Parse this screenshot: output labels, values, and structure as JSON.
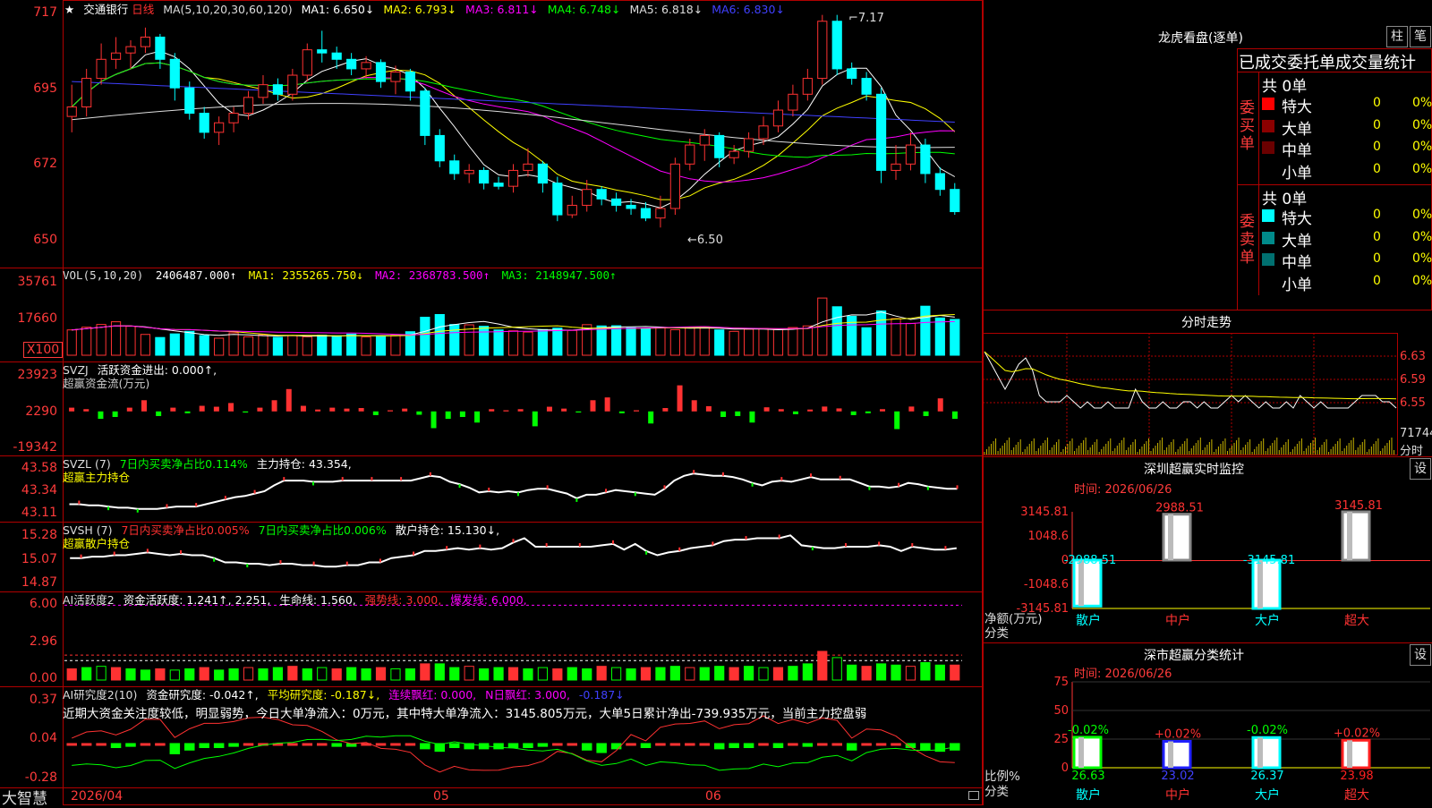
{
  "app": {
    "brand": "大智慧",
    "date_axis": [
      "2026/04",
      "05",
      "06"
    ]
  },
  "main": {
    "name": "交通银行",
    "period": "日线",
    "ma_label": "MA(5,10,20,30,60,120)",
    "ma1": "MA1: 6.650↓",
    "ma2": "MA2: 6.793↓",
    "ma3": "MA3: 6.811↓",
    "ma4": "MA4: 6.748↓",
    "ma5": "MA5: 6.818↓",
    "ma6": "MA6: 6.830↓",
    "high_mark": "7.17",
    "low_mark": "←6.50",
    "ticks": [
      "717",
      "695",
      "672",
      "650"
    ]
  },
  "vol": {
    "label": "VOL(5,10,20)",
    "v": "2406487.000↑",
    "ma1": "MA1: 2355265.750↓",
    "ma2": "MA2: 2368783.500↑",
    "ma3": "MA3: 2148947.500↑",
    "ticks": [
      "35761",
      "17660",
      "X100"
    ]
  },
  "svzj": {
    "label": "SVZJ",
    "l1": "活跃资金进出: 0.000↑,",
    "l2": "超赢资金流(万元)",
    "ticks": [
      "23923",
      "2290",
      "-19342"
    ]
  },
  "svzl": {
    "label": "SVZL (7)",
    "l1": "7日内买卖净占比0.114%",
    "l2": "主力持仓: 43.354,",
    "l3": "超赢主力持仓",
    "ticks": [
      "43.58",
      "43.34",
      "43.11"
    ]
  },
  "svsh": {
    "label": "SVSH (7)",
    "l1": "7日内买卖净占比0.005%",
    "l2": "7日内买卖净占比0.006%",
    "l3": "散户持仓: 15.130↓,",
    "l4": "超赢散户持仓",
    "ticks": [
      "15.28",
      "15.07",
      "14.87"
    ]
  },
  "ai1": {
    "label": "AI活跃度2",
    "l1": "资金活跃度: 1.241↑, 2.251,",
    "l2": "生命线: 1.560,",
    "l3": "强势线: 3.000,",
    "l4": "爆发线: 6.000,",
    "ticks": [
      "6.00",
      "2.96",
      "0.00"
    ]
  },
  "ai2": {
    "label": "AI研究度2(10)",
    "l1": "资金研究度: -0.042↑,",
    "l2": "平均研究度: -0.187↓,",
    "l3": "连续飘红: 0.000,",
    "l4": "N日飘红: 3.000,",
    "l5": "-0.187↓",
    "comment": "近期大资金关注度较低，明显弱势，今日大单净流入：0万元，其中特大单净流入：3145.805万元，大单5日累计净出-739.935万元，当前主力控盘弱",
    "ticks": [
      "0.37",
      "0.04",
      "-0.28"
    ]
  },
  "lhb": {
    "title": "龙虎看盘(逐单)",
    "btn1": "柱",
    "btn2": "笔",
    "tabs": [
      "已成交",
      "委托单",
      "成交量统计"
    ],
    "buy": {
      "side": "委买单",
      "total": "共 0单",
      "rows": [
        {
          "name": "特大",
          "v": "0",
          "p": "0%",
          "c": "#ff0000"
        },
        {
          "name": "大单",
          "v": "0",
          "p": "0%",
          "c": "#8b0000"
        },
        {
          "name": "中单",
          "v": "0",
          "p": "0%",
          "c": "#6a0000"
        },
        {
          "name": "小单",
          "v": "0",
          "p": "0%",
          "c": ""
        }
      ]
    },
    "sell": {
      "side": "委卖单",
      "total": "共 0单",
      "rows": [
        {
          "name": "特大",
          "v": "0",
          "p": "0%",
          "c": "#00ffff"
        },
        {
          "name": "大单",
          "v": "0",
          "p": "0%",
          "c": "#008b8b"
        },
        {
          "name": "中单",
          "v": "0",
          "p": "0%",
          "c": "#007070"
        },
        {
          "name": "小单",
          "v": "0",
          "p": "0%",
          "c": ""
        }
      ]
    }
  },
  "fenshi": {
    "title": "分时走势",
    "ticks": [
      "6.63",
      "6.59",
      "6.55"
    ],
    "vol_tick": "71744",
    "footer": "分时"
  },
  "monitor": {
    "title": "深圳超赢实时监控",
    "btn": "设",
    "time": "时间: 2026/06/26",
    "ticks": [
      "3145.81",
      "1048.6",
      "0",
      "-1048.6",
      "-3145.81"
    ],
    "axis_title": "净额(万元)",
    "axis_cat": "分类"
  },
  "stats": {
    "title": "深市超赢分类统计",
    "btn": "设",
    "time": "时间: 2026/06/26",
    "ticks": [
      "75",
      "50",
      "25",
      "0"
    ],
    "axis_title": "比例%",
    "axis_cat": "分类"
  },
  "chart_data": [
    {
      "type": "candlestick",
      "title": "交通银行 日线",
      "ylim": [
        6.45,
        7.2
      ],
      "x": [
        "2026/04",
        "05",
        "06"
      ],
      "candles": [
        [
          6.85,
          6.88,
          6.95,
          6.8
        ],
        [
          6.88,
          6.97,
          7.0,
          6.85
        ],
        [
          6.97,
          7.03,
          7.08,
          6.95
        ],
        [
          7.03,
          7.05,
          7.1,
          7.0
        ],
        [
          7.05,
          7.07,
          7.09,
          7.0
        ],
        [
          7.07,
          7.1,
          7.13,
          7.05
        ],
        [
          7.1,
          7.03,
          7.11,
          7.0
        ],
        [
          7.03,
          6.94,
          7.05,
          6.9
        ],
        [
          6.94,
          6.86,
          6.96,
          6.84
        ],
        [
          6.86,
          6.8,
          6.88,
          6.78
        ],
        [
          6.8,
          6.83,
          6.85,
          6.76
        ],
        [
          6.83,
          6.86,
          6.88,
          6.8
        ],
        [
          6.86,
          6.91,
          6.93,
          6.84
        ],
        [
          6.91,
          6.95,
          6.98,
          6.89
        ],
        [
          6.95,
          6.92,
          6.97,
          6.9
        ],
        [
          6.92,
          6.98,
          7.0,
          6.9
        ],
        [
          6.98,
          7.06,
          7.08,
          6.96
        ],
        [
          7.06,
          7.05,
          7.12,
          7.02
        ],
        [
          7.05,
          7.03,
          7.07,
          7.0
        ],
        [
          7.03,
          7.0,
          7.05,
          6.98
        ],
        [
          7.0,
          7.02,
          7.04,
          6.97
        ],
        [
          7.02,
          6.96,
          7.03,
          6.94
        ],
        [
          6.96,
          6.99,
          7.01,
          6.92
        ],
        [
          6.99,
          6.93,
          7.0,
          6.9
        ],
        [
          6.93,
          6.79,
          6.94,
          6.76
        ],
        [
          6.79,
          6.71,
          6.81,
          6.69
        ],
        [
          6.71,
          6.67,
          6.73,
          6.65
        ],
        [
          6.67,
          6.68,
          6.7,
          6.64
        ],
        [
          6.68,
          6.64,
          6.69,
          6.62
        ],
        [
          6.64,
          6.63,
          6.66,
          6.62
        ],
        [
          6.63,
          6.68,
          6.7,
          6.61
        ],
        [
          6.68,
          6.7,
          6.75,
          6.66
        ],
        [
          6.7,
          6.64,
          6.71,
          6.61
        ],
        [
          6.64,
          6.54,
          6.66,
          6.52
        ],
        [
          6.54,
          6.57,
          6.6,
          6.53
        ],
        [
          6.57,
          6.62,
          6.65,
          6.55
        ],
        [
          6.62,
          6.59,
          6.63,
          6.57
        ],
        [
          6.59,
          6.57,
          6.61,
          6.55
        ],
        [
          6.57,
          6.56,
          6.59,
          6.54
        ],
        [
          6.56,
          6.53,
          6.58,
          6.52
        ],
        [
          6.53,
          6.56,
          6.6,
          6.5
        ],
        [
          6.56,
          6.7,
          6.72,
          6.54
        ],
        [
          6.7,
          6.76,
          6.78,
          6.68
        ],
        [
          6.76,
          6.79,
          6.81,
          6.71
        ],
        [
          6.79,
          6.72,
          6.8,
          6.69
        ],
        [
          6.72,
          6.74,
          6.76,
          6.7
        ],
        [
          6.74,
          6.78,
          6.8,
          6.72
        ],
        [
          6.78,
          6.82,
          6.85,
          6.76
        ],
        [
          6.82,
          6.87,
          6.9,
          6.8
        ],
        [
          6.87,
          6.92,
          6.95,
          6.85
        ],
        [
          6.92,
          6.97,
          7.0,
          6.9
        ],
        [
          6.97,
          7.15,
          7.17,
          6.95
        ],
        [
          7.15,
          7.0,
          7.17,
          6.98
        ],
        [
          7.0,
          6.97,
          7.02,
          6.95
        ],
        [
          6.97,
          6.92,
          6.99,
          6.9
        ],
        [
          6.92,
          6.68,
          6.94,
          6.64
        ],
        [
          6.68,
          6.7,
          6.76,
          6.65
        ],
        [
          6.7,
          6.76,
          6.8,
          6.68
        ],
        [
          6.76,
          6.67,
          6.78,
          6.64
        ],
        [
          6.67,
          6.62,
          6.69,
          6.6
        ],
        [
          6.62,
          6.55,
          6.64,
          6.54
        ]
      ],
      "series": [
        {
          "name": "MA1",
          "value": 6.65
        },
        {
          "name": "MA2",
          "value": 6.793
        },
        {
          "name": "MA3",
          "value": 6.811
        },
        {
          "name": "MA4",
          "value": 6.748
        },
        {
          "name": "MA5",
          "value": 6.818
        },
        {
          "name": "MA6",
          "value": 6.83
        }
      ],
      "annotations": [
        "7.17",
        "←6.50"
      ]
    },
    {
      "type": "bar",
      "title": "VOL(5,10,20)",
      "ylim": [
        0,
        45000
      ],
      "values": [
        14000,
        15500,
        17000,
        18500,
        16000,
        11500,
        9800,
        11800,
        13200,
        10900,
        9400,
        12400,
        10200,
        11300,
        9900,
        10800,
        10200,
        11100,
        10800,
        11700,
        10100,
        10600,
        11000,
        13000,
        21000,
        22500,
        17000,
        16800,
        16000,
        14000,
        13500,
        12800,
        14200,
        15000,
        13700,
        16900,
        16200,
        16300,
        15200,
        14800,
        15300,
        14100,
        15500,
        15700,
        14000,
        13200,
        14400,
        14800,
        14100,
        15300,
        16200,
        31600,
        26800,
        21500,
        15200,
        24500,
        20200,
        17600,
        27100,
        20600,
        19800
      ],
      "series": [
        {
          "name": "VOL",
          "value": 2406487.0
        },
        {
          "name": "MA1",
          "value": 2355265.75
        },
        {
          "name": "MA2",
          "value": 2368783.5
        },
        {
          "name": "MA3",
          "value": 2148947.5
        }
      ]
    },
    {
      "type": "bar",
      "title": "超赢资金流(万元)",
      "ylim": [
        -19342,
        23923
      ],
      "values": [
        2000,
        1200,
        -4000,
        -3000,
        2000,
        6000,
        -2500,
        2000,
        -1000,
        3000,
        2500,
        4500,
        -600,
        2000,
        6000,
        12000,
        3000,
        1000,
        2000,
        1500,
        1800,
        -2000,
        600,
        1500,
        -1800,
        -9000,
        -4000,
        -3000,
        -6000,
        1200,
        600,
        1200,
        -8000,
        2500,
        1500,
        -600,
        6000,
        7500,
        -1000,
        600,
        -6500,
        1800,
        14000,
        6000,
        2800,
        -3000,
        -2500,
        -6000,
        2200,
        1200,
        -1500,
        1000,
        2600,
        1600,
        -2000,
        -1000,
        1200,
        -9500,
        2600,
        -2500,
        7000,
        -4000
      ],
      "series": [
        {
          "name": "活跃资金进出",
          "value": 0.0
        }
      ]
    },
    {
      "type": "line",
      "title": "超赢主力持仓",
      "ylim": [
        43.11,
        43.58
      ],
      "values": [
        43.22,
        43.22,
        43.21,
        43.21,
        43.2,
        43.19,
        43.19,
        43.18,
        43.18,
        43.18,
        43.19,
        43.2,
        43.2,
        43.2,
        43.22,
        43.24,
        43.26,
        43.28,
        43.29,
        43.31,
        43.33,
        43.38,
        43.42,
        43.42,
        43.42,
        43.41,
        43.41,
        43.41,
        43.42,
        43.42,
        43.42,
        43.42,
        43.42,
        43.42,
        43.42,
        43.42,
        43.44,
        43.46,
        43.45,
        43.41,
        43.39,
        43.36,
        43.32,
        43.33,
        43.32,
        43.33,
        43.32,
        43.34,
        43.35,
        43.35,
        43.33,
        43.31,
        43.27,
        43.3,
        43.3,
        43.32,
        43.34,
        43.33,
        43.32,
        43.31,
        43.3,
        43.35,
        43.42,
        43.46,
        43.48,
        43.47,
        43.46,
        43.46,
        43.45,
        43.43,
        43.4,
        43.38,
        43.41,
        43.42,
        43.41,
        43.43,
        43.45,
        43.43,
        43.43,
        43.43,
        43.43,
        43.4,
        43.37,
        43.37,
        43.36,
        43.37,
        43.4,
        43.39,
        43.37,
        43.36,
        43.35,
        43.35
      ]
    },
    {
      "type": "line",
      "title": "超赢散户持仓",
      "ylim": [
        14.87,
        15.28
      ],
      "values": [
        15.08,
        15.08,
        15.09,
        15.09,
        15.1,
        15.1,
        15.11,
        15.12,
        15.11,
        15.1,
        15.11,
        15.1,
        15.1,
        15.08,
        15.05,
        15.05,
        15.04,
        15.04,
        15.03,
        15.04,
        15.04,
        15.03,
        15.03,
        15.02,
        15.02,
        15.03,
        15.03,
        15.05,
        15.05,
        15.08,
        15.09,
        15.1,
        15.13,
        15.13,
        15.14,
        15.15,
        15.14,
        15.15,
        15.14,
        15.15,
        15.19,
        15.22,
        15.16,
        15.16,
        15.16,
        15.16,
        15.16,
        15.16,
        15.17,
        15.18,
        15.14,
        15.18,
        15.13,
        15.1,
        15.12,
        15.13,
        15.15,
        15.16,
        15.17,
        15.2,
        15.21,
        15.21,
        15.22,
        15.22,
        15.22,
        15.24,
        15.17,
        15.16,
        15.15,
        15.15,
        15.16,
        15.16,
        15.16,
        15.17,
        15.16,
        15.13,
        15.16,
        15.15,
        15.14,
        15.14,
        15.15
      ],
      "series": [
        {
          "name": "散户持仓",
          "value": 15.13
        }
      ]
    },
    {
      "type": "bar",
      "title": "AI活跃度2",
      "ylim": [
        0,
        6.6
      ],
      "values": [
        0.9,
        1.0,
        1.1,
        1.0,
        0.9,
        0.8,
        0.9,
        0.8,
        0.9,
        1.0,
        0.8,
        0.9,
        1.0,
        0.9,
        1.0,
        1.1,
        0.9,
        1.0,
        0.9,
        1.0,
        0.9,
        1.0,
        0.9,
        0.9,
        1.3,
        1.3,
        1.0,
        1.1,
        0.9,
        1.0,
        1.0,
        0.9,
        1.0,
        0.9,
        1.0,
        0.9,
        1.1,
        1.0,
        0.9,
        1.0,
        1.0,
        1.1,
        1.0,
        1.0,
        1.1,
        1.0,
        1.1,
        1.0,
        1.0,
        1.1,
        1.3,
        2.3,
        1.8,
        1.2,
        1.1,
        1.3,
        1.2,
        1.1,
        1.4,
        1.2,
        1.2
      ],
      "series": [
        {
          "name": "资金活跃度",
          "value": 1.241
        },
        {
          "name": "生命线",
          "value": 1.56
        },
        {
          "name": "强势线",
          "value": 3.0
        },
        {
          "name": "爆发线",
          "value": 6.0
        }
      ]
    },
    {
      "type": "bar",
      "title": "AI研究度2(10)",
      "ylim": [
        -0.28,
        0.37
      ],
      "values": [
        0.01,
        0.02,
        0.01,
        -0.02,
        -0.01,
        0.02,
        0.01,
        -0.07,
        -0.04,
        -0.02,
        -0.02,
        -0.01,
        0.01,
        0.02,
        0.02,
        0.01,
        0.02,
        0.01,
        -0.01,
        -0.01,
        0.01,
        0.0,
        0.01,
        0.01,
        -0.03,
        -0.05,
        -0.02,
        -0.03,
        -0.03,
        -0.03,
        -0.02,
        -0.02,
        -0.01,
        0.02,
        0.0,
        -0.04,
        -0.06,
        -0.03,
        0.02,
        -0.02,
        0.02,
        0.02,
        0.01,
        0.01,
        -0.03,
        -0.02,
        -0.02,
        0.01,
        -0.02,
        0.0,
        -0.01,
        0.02,
        0.02,
        -0.04,
        0.01,
        0.02,
        0.01,
        -0.02,
        -0.04,
        -0.05,
        -0.04
      ],
      "series": [
        {
          "name": "资金研究度",
          "value": -0.042
        },
        {
          "name": "平均研究度",
          "value": -0.187
        }
      ]
    },
    {
      "type": "line",
      "title": "分时走势",
      "ylim": [
        6.51,
        6.65
      ],
      "values": [
        6.62,
        6.6,
        6.58,
        6.56,
        6.58,
        6.6,
        6.61,
        6.59,
        6.55,
        6.54,
        6.54,
        6.54,
        6.55,
        6.54,
        6.53,
        6.54,
        6.53,
        6.53,
        6.54,
        6.53,
        6.53,
        6.53,
        6.56,
        6.54,
        6.53,
        6.53,
        6.54,
        6.53,
        6.53,
        6.54,
        6.54,
        6.53,
        6.54,
        6.53,
        6.53,
        6.54,
        6.55,
        6.54,
        6.55,
        6.54,
        6.53,
        6.54,
        6.53,
        6.53,
        6.54,
        6.53,
        6.55,
        6.54,
        6.53,
        6.54,
        6.53,
        6.53,
        6.53,
        6.53,
        6.54,
        6.55,
        6.55,
        6.55,
        6.54,
        6.54,
        6.53
      ]
    },
    {
      "type": "bar",
      "title": "深圳超赢实时监控",
      "ylim": [
        -3145.81,
        3145.81
      ],
      "categories": [
        "散户",
        "中户",
        "大户",
        "超大"
      ],
      "values": [
        -2988.51,
        2988.51,
        -3145.81,
        3145.81
      ],
      "labels": [
        "-2988.51",
        "2988.51",
        "-3145.81",
        "3145.81"
      ]
    },
    {
      "type": "bar",
      "title": "深市超赢分类统计",
      "ylim": [
        0,
        75
      ],
      "categories": [
        "散户",
        "中户",
        "大户",
        "超大"
      ],
      "values": [
        26.63,
        23.02,
        26.37,
        23.98
      ],
      "labels": [
        "26.63",
        "23.02",
        "26.37",
        "23.98"
      ],
      "change": [
        "-0.02%",
        "+0.02%",
        "-0.02%",
        "+0.02%"
      ],
      "colors": [
        "#00ff00",
        "#2020ff",
        "#00ffff",
        "#ff2020"
      ]
    }
  ]
}
